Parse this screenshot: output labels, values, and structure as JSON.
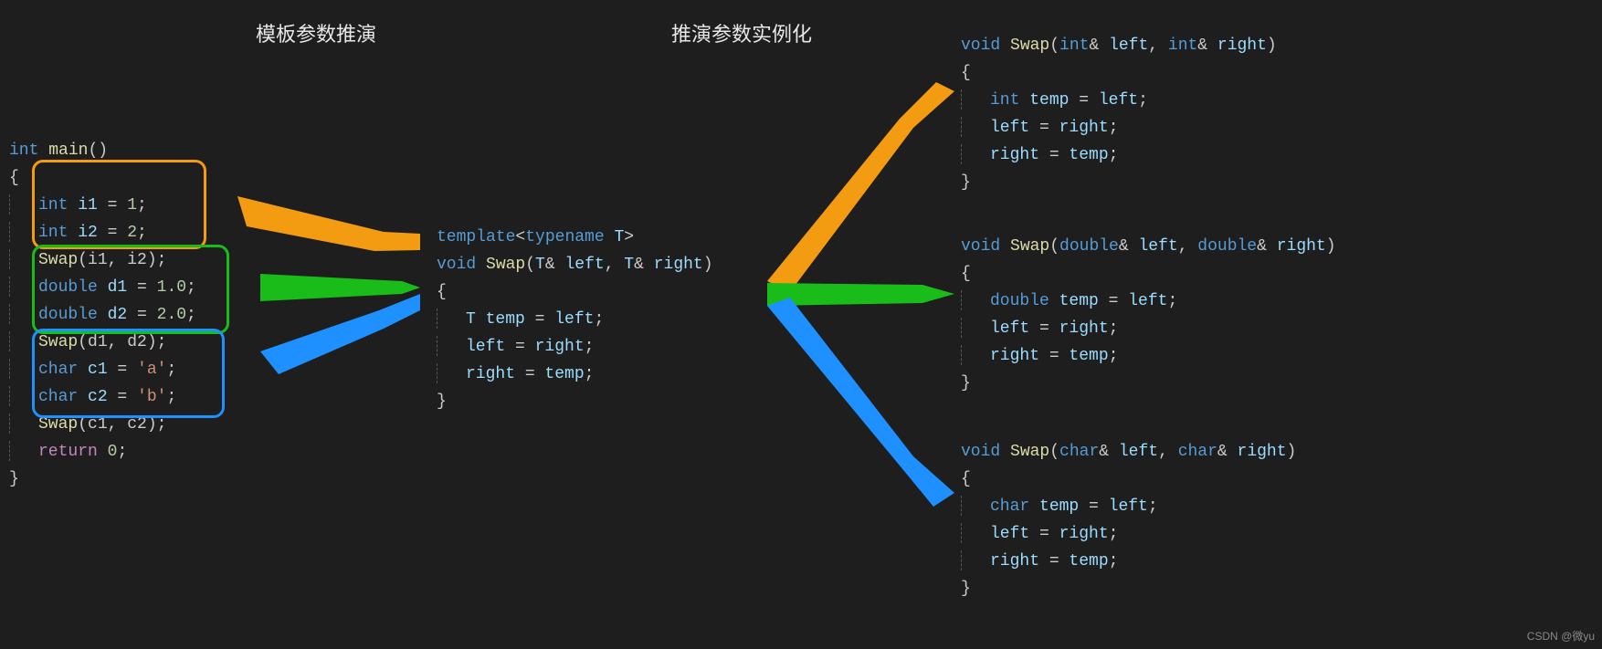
{
  "headings": {
    "left": "模板参数推演",
    "right": "推演参数实例化"
  },
  "watermark": "CSDN @微yu",
  "main": {
    "sig": "int main()",
    "open": "{",
    "l1_pre": "int ",
    "l1_var": "i1",
    "l1_mid": " = ",
    "l1_val": "1",
    "l1_end": ";",
    "l2_pre": "int ",
    "l2_var": "i2",
    "l2_mid": " = ",
    "l2_val": "2",
    "l2_end": ";",
    "l3_fn": "Swap",
    "l3_args": "(i1, i2);",
    "l4_pre": "double ",
    "l4_var": "d1",
    "l4_mid": " = ",
    "l4_val": "1.0",
    "l4_end": ";",
    "l5_pre": "double ",
    "l5_var": "d2",
    "l5_mid": " = ",
    "l5_val": "2.0",
    "l5_end": ";",
    "l6_fn": "Swap",
    "l6_args": "(d1, d2);",
    "l7_pre": "char ",
    "l7_var": "c1",
    "l7_mid": " = ",
    "l7_val": "'a'",
    "l7_end": ";",
    "l8_pre": "char ",
    "l8_var": "c2",
    "l8_mid": " = ",
    "l8_val": "'b'",
    "l8_end": ";",
    "l9_fn": "Swap",
    "l9_args": "(c1, c2);",
    "ret": "return ",
    "ret_val": "0",
    "ret_end": ";",
    "close": "}"
  },
  "template": {
    "l1a": "template",
    "l1b": "<",
    "l1c": "typename ",
    "l1d": "T",
    "l1e": ">",
    "l2a": "void ",
    "l2b": "Swap",
    "l2c": "(",
    "l2d": "T",
    "l2e": "& ",
    "l2f": "left",
    "l2g": ", ",
    "l2h": "T",
    "l2i": "& ",
    "l2j": "right",
    "l2k": ")",
    "open": "{",
    "l3a": "T ",
    "l3b": "temp",
    "l3c": " = ",
    "l3d": "left",
    "l3e": ";",
    "l4a": "left",
    "l4b": " = ",
    "l4c": "right",
    "l4d": ";",
    "l5a": "right",
    "l5b": " = ",
    "l5c": "temp",
    "l5d": ";",
    "close": "}"
  },
  "inst_int": {
    "sig_a": "void ",
    "sig_b": "Swap",
    "sig_c": "(",
    "sig_d": "int",
    "sig_e": "& ",
    "sig_f": "left",
    "sig_g": ", ",
    "sig_h": "int",
    "sig_i": "& ",
    "sig_j": "right",
    "sig_k": ")",
    "open": "{",
    "l1a": "int ",
    "l1b": "temp",
    "l1c": " = ",
    "l1d": "left",
    "l1e": ";",
    "l2a": "left",
    "l2b": " = ",
    "l2c": "right",
    "l2d": ";",
    "l3a": "right",
    "l3b": " = ",
    "l3c": "temp",
    "l3d": ";",
    "close": "}"
  },
  "inst_double": {
    "sig_a": "void ",
    "sig_b": "Swap",
    "sig_c": "(",
    "sig_d": "double",
    "sig_e": "& ",
    "sig_f": "left",
    "sig_g": ", ",
    "sig_h": "double",
    "sig_i": "& ",
    "sig_j": "right",
    "sig_k": ")",
    "open": "{",
    "l1a": "double ",
    "l1b": "temp",
    "l1c": " = ",
    "l1d": "left",
    "l1e": ";",
    "l2a": "left",
    "l2b": " = ",
    "l2c": "right",
    "l2d": ";",
    "l3a": "right",
    "l3b": " = ",
    "l3c": "temp",
    "l3d": ";",
    "close": "}"
  },
  "inst_char": {
    "sig_a": "void ",
    "sig_b": "Swap",
    "sig_c": "(",
    "sig_d": "char",
    "sig_e": "& ",
    "sig_f": "left",
    "sig_g": ", ",
    "sig_h": "char",
    "sig_i": "& ",
    "sig_j": "right",
    "sig_k": ")",
    "open": "{",
    "l1a": "char ",
    "l1b": "temp",
    "l1c": " = ",
    "l1d": "left",
    "l1e": ";",
    "l2a": "left",
    "l2b": " = ",
    "l2c": "right",
    "l2d": ";",
    "l3a": "right",
    "l3b": " = ",
    "l3c": "temp",
    "l3d": ";",
    "close": "}"
  }
}
